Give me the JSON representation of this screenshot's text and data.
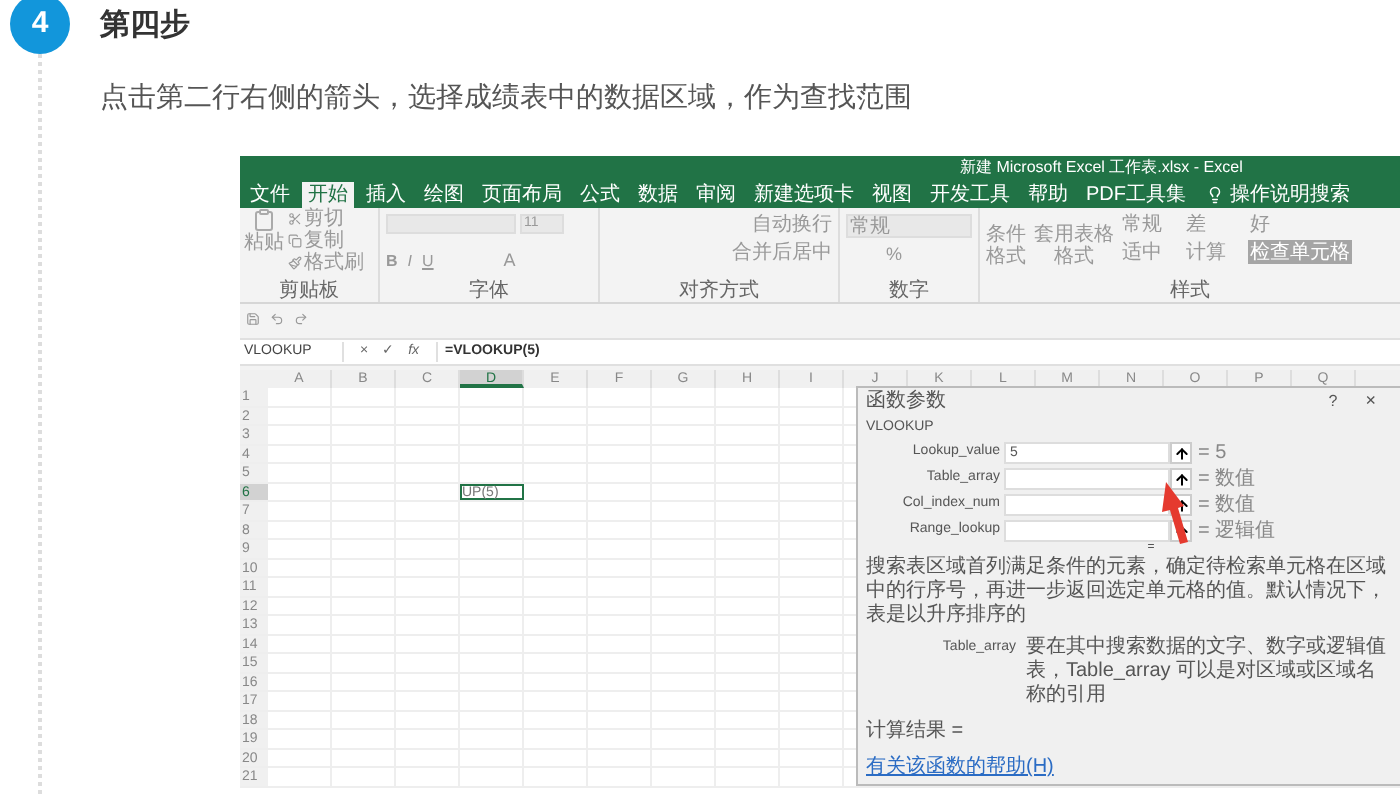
{
  "step": {
    "number": "4",
    "title": "第四步",
    "instruction": "点击第二行右侧的箭头，选择成绩表中的数据区域，作为查找范围"
  },
  "excel": {
    "title": "新建 Microsoft Excel 工作表.xlsx  -  Excel",
    "tabs": [
      {
        "label": "文件",
        "selected": false
      },
      {
        "label": "开始",
        "selected": true
      },
      {
        "label": "插入",
        "selected": false
      },
      {
        "label": "绘图",
        "selected": false
      },
      {
        "label": "页面布局",
        "selected": false
      },
      {
        "label": "公式",
        "selected": false
      },
      {
        "label": "数据",
        "selected": false
      },
      {
        "label": "审阅",
        "selected": false
      },
      {
        "label": "新建选项卡",
        "selected": false
      },
      {
        "label": "视图",
        "selected": false
      },
      {
        "label": "开发工具",
        "selected": false
      },
      {
        "label": "帮助",
        "selected": false
      },
      {
        "label": "PDF工具集",
        "selected": false
      }
    ],
    "tell_me": "操作说明搜索",
    "ribbon": {
      "clipboard": {
        "paste": "粘贴",
        "items": [
          "剪切",
          "复制",
          "格式刷"
        ],
        "label": "剪贴板"
      },
      "font": {
        "size": "11",
        "buttons": [
          "B",
          "I",
          "U"
        ],
        "color_letter": "A",
        "label": "字体"
      },
      "alignment": {
        "wrap": "自动换行",
        "merge": "合并后居中",
        "label": "对齐方式"
      },
      "number": {
        "format": "常规",
        "percent": "%",
        "label": "数字"
      },
      "styles": {
        "conditional": "条件格式",
        "table": "套用表格格式",
        "cells": [
          {
            "label": "常规",
            "kind": "plain"
          },
          {
            "label": "差",
            "kind": "plain"
          },
          {
            "label": "好",
            "kind": "plain"
          },
          {
            "label": "适中",
            "kind": "plain"
          },
          {
            "label": "计算",
            "kind": "plain"
          },
          {
            "label": "检查单元格",
            "kind": "dark"
          }
        ],
        "label": "样式"
      }
    },
    "name_box": "VLOOKUP",
    "formula_buttons": [
      "×",
      "✓",
      "fx"
    ],
    "formula": "=VLOOKUP(5)",
    "columns": [
      {
        "label": "A",
        "selected": false
      },
      {
        "label": "B",
        "selected": false
      },
      {
        "label": "C",
        "selected": false
      },
      {
        "label": "D",
        "selected": true
      },
      {
        "label": "E",
        "selected": false
      },
      {
        "label": "F",
        "selected": false
      },
      {
        "label": "G",
        "selected": false
      },
      {
        "label": "H",
        "selected": false
      },
      {
        "label": "I",
        "selected": false
      },
      {
        "label": "J",
        "selected": false
      },
      {
        "label": "K",
        "selected": false
      },
      {
        "label": "L",
        "selected": false
      },
      {
        "label": "M",
        "selected": false
      },
      {
        "label": "N",
        "selected": false
      },
      {
        "label": "O",
        "selected": false
      },
      {
        "label": "P",
        "selected": false
      },
      {
        "label": "Q",
        "selected": false
      }
    ],
    "rows": [
      {
        "label": "1",
        "selected": false
      },
      {
        "label": "2",
        "selected": false
      },
      {
        "label": "3",
        "selected": false
      },
      {
        "label": "4",
        "selected": false
      },
      {
        "label": "5",
        "selected": false
      },
      {
        "label": "6",
        "selected": true
      },
      {
        "label": "7",
        "selected": false
      },
      {
        "label": "8",
        "selected": false
      },
      {
        "label": "9",
        "selected": false
      },
      {
        "label": "10",
        "selected": false
      },
      {
        "label": "11",
        "selected": false
      },
      {
        "label": "12",
        "selected": false
      },
      {
        "label": "13",
        "selected": false
      },
      {
        "label": "14",
        "selected": false
      },
      {
        "label": "15",
        "selected": false
      },
      {
        "label": "16",
        "selected": false
      },
      {
        "label": "17",
        "selected": false
      },
      {
        "label": "18",
        "selected": false
      },
      {
        "label": "19",
        "selected": false
      },
      {
        "label": "20",
        "selected": false
      },
      {
        "label": "21",
        "selected": false
      }
    ],
    "cell_text": "UP(5)",
    "dialog": {
      "title": "函数参数",
      "help": "?",
      "close": "×",
      "function": "VLOOKUP",
      "args": [
        {
          "name": "Lookup_value",
          "value": "5",
          "result": "= 5"
        },
        {
          "name": "Table_array",
          "result": "= 数值"
        },
        {
          "name": "Col_index_num",
          "result": "= 数值"
        },
        {
          "name": "Range_lookup",
          "result": "= 逻辑值"
        }
      ],
      "more_mark": "=",
      "description": "搜索表区域首列满足条件的元素，确定待检索单元格在区域中的行序号，再进一步返回选定单元格的值。默认情况下，表是以升序排序的",
      "arg_help": {
        "name": "Table_array",
        "text": "要在其中搜索数据的文字、数字或逻辑值表，Table_array 可以是对区域或区域名称的引用"
      },
      "result_label": "计算结果 =",
      "help_link": "有关该函数的帮助(H)"
    }
  }
}
